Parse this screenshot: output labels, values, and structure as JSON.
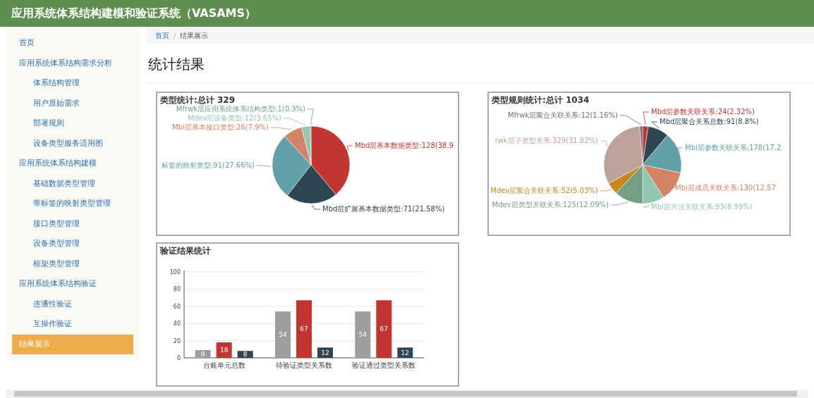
{
  "header": {
    "title": "应用系统体系结构建模和验证系统（VASAMS）"
  },
  "sidebar": {
    "items": [
      {
        "label": "首页",
        "selected": false
      },
      {
        "label": "应用系统体系结构需求分析",
        "selected": false,
        "children": [
          {
            "label": "体系结构管理",
            "selected": false
          },
          {
            "label": "用户原始需求",
            "selected": false
          },
          {
            "label": "部署规则",
            "selected": false
          },
          {
            "label": "设备类型服务适用图",
            "selected": false
          }
        ]
      },
      {
        "label": "应用系统体系结构建模",
        "selected": false,
        "children": [
          {
            "label": "基础数据类型管理",
            "selected": false
          },
          {
            "label": "带标签的映射类型管理",
            "selected": false
          },
          {
            "label": "接口类型管理",
            "selected": false
          },
          {
            "label": "设备类型管理",
            "selected": false
          },
          {
            "label": "框架类型管理",
            "selected": false
          }
        ]
      },
      {
        "label": "应用系统体系结构验证",
        "selected": false,
        "children": [
          {
            "label": "连通性验证",
            "selected": false
          },
          {
            "label": "互操作验证",
            "selected": false
          }
        ]
      },
      {
        "label": "结果展示",
        "selected": true
      }
    ]
  },
  "breadcrumb": [
    {
      "label": "首页",
      "kind": "link"
    },
    {
      "label": "/",
      "kind": "separator"
    },
    {
      "label": "结果展示",
      "kind": "current"
    }
  ],
  "page_title": "统计结果",
  "charts": [
    {
      "chart_data": {
        "type": "pie",
        "title": "类型统计:总计 329",
        "values": [
          128,
          71,
          91,
          26,
          12,
          1
        ],
        "colors": [
          "#c23531",
          "#2f4554",
          "#61a0a8",
          "#d48265",
          "#91c7ae",
          "#749f83"
        ],
        "value_labels": [
          "Mbd层基本数据类型:128(38.9",
          "Mbd层扩展基本数据类型:71(21.58%)",
          "标签的映射类型:91(27.66%)",
          "Mbi层基本接口类型:26(7.9%)",
          "Mdev层设备类型:12(3.65%)",
          "Mfrwk层应用系统体系结构类型:1(0.3%)"
        ]
      }
    },
    {
      "chart_data": {
        "type": "pie",
        "title": "类型规则统计:总计 1034",
        "values": [
          24,
          91,
          178,
          130,
          93,
          125,
          52,
          329,
          12
        ],
        "colors": [
          "#c23531",
          "#2f4554",
          "#61a0a8",
          "#d48265",
          "#91c7ae",
          "#749f83",
          "#ca8622",
          "#bda29a",
          "#6e7074"
        ],
        "value_labels": [
          "Mbd层参数关联关系:24(2.32%)",
          "Mbd层聚合关系总数:91(8.8%)",
          "Mbi层参数关联关系:178(17.2",
          "Mbi层成员关联关系:130(12.57",
          "Mbi层方法关联关系:93(8.99%)",
          "Mdev层类型关联关系:125(12.09%)",
          "Mdev层聚合关联关系:52(5.03%)",
          "rwk层子类型关系:329(31.82%)",
          "Mfrwk层聚合关联关系:12(1.16%)"
        ]
      }
    },
    {
      "chart_data": {
        "type": "bar",
        "title": "验证结果统计",
        "categories": [
          "台账单元总数",
          "待验证类型关系数",
          "验证通过类型关系数"
        ],
        "series": [
          {
            "color": "#9e9e9e",
            "values": [
              9,
              54,
              54
            ]
          },
          {
            "color": "#c23531",
            "values": [
              18,
              67,
              67
            ]
          },
          {
            "color": "#2f4554",
            "values": [
              8,
              12,
              12
            ]
          }
        ],
        "ylim": [
          0,
          100
        ],
        "grid": true,
        "yticks": [
          0,
          20,
          40,
          60,
          80,
          100
        ],
        "data_labels": true
      }
    }
  ]
}
